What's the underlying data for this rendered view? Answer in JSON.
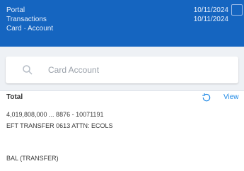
{
  "header": {
    "left_line1": "Portal",
    "left_line2": "Transactions",
    "left_line3": "Card · Account",
    "right_line1": "10/11/2024",
    "right_line2": "10/11/2024"
  },
  "search": {
    "placeholder": "Card Account"
  },
  "section": {
    "title": "Total",
    "link": "View",
    "line1": "4,019,808,000 ...   8876 - 10071191",
    "line2": "EFT TRANSFER 0613 ATTN: ECOLS",
    "line3": "BAL (TRANSFER)"
  },
  "colors": {
    "header_bg": "#1565c0",
    "accent": "#1e88e5"
  }
}
